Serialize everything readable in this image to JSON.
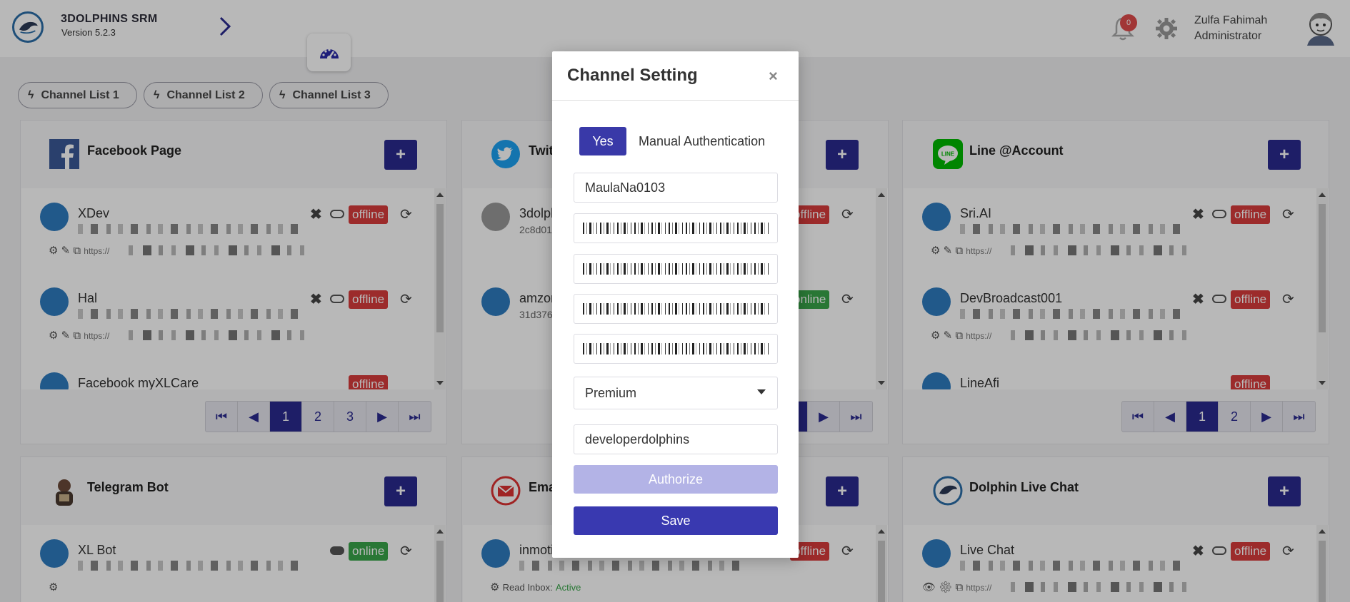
{
  "app": {
    "name": "3DOLPHINS SRM",
    "version": "Version 5.2.3"
  },
  "header": {
    "notification_count": "0",
    "user_name": "Zulfa Fahimah",
    "user_role": "Administrator"
  },
  "tabs": [
    {
      "label": "Channel List 1"
    },
    {
      "label": "Channel List 2"
    },
    {
      "label": "Channel List 3"
    }
  ],
  "panels": {
    "facebook": {
      "title": "Facebook Page",
      "items": [
        {
          "name": "XDev",
          "status": "offline",
          "url_prefix": "https://"
        },
        {
          "name": "Hal",
          "status": "offline",
          "url_prefix": "https://"
        },
        {
          "name": "Facebook myXLCare",
          "status": "offline"
        }
      ],
      "pages": [
        "1",
        "2",
        "3"
      ],
      "active_page": "1"
    },
    "twitter": {
      "title": "Twit",
      "items": [
        {
          "name": "3dolph",
          "sub": "2c8d01",
          "status": "offline"
        },
        {
          "name": "amzon",
          "sub": "31d376",
          "status": "online"
        }
      ]
    },
    "line": {
      "title": "Line @Account",
      "items": [
        {
          "name": "Sri.AI",
          "status": "offline",
          "url_prefix": "https://"
        },
        {
          "name": "DevBroadcast001",
          "status": "offline",
          "url_prefix": "https://"
        },
        {
          "name": "LineAfi",
          "status": "offline"
        }
      ],
      "pages": [
        "1",
        "2"
      ],
      "active_page": "1"
    },
    "telegram": {
      "title": "Telegram Bot",
      "items": [
        {
          "name": "XL Bot",
          "status": "online"
        }
      ]
    },
    "email": {
      "title": "Ema",
      "items": [
        {
          "name": "inmoti",
          "status": "offline",
          "read_inbox_label": "Read Inbox:",
          "read_inbox_value": "Active"
        }
      ]
    },
    "livechat": {
      "title": "Dolphin Live Chat",
      "items": [
        {
          "name": "Live Chat",
          "status": "offline",
          "url_prefix": "https://"
        }
      ]
    }
  },
  "modal": {
    "title": "Channel Setting",
    "close": "×",
    "yes_label": "Yes",
    "manual_auth_label": "Manual Authentication",
    "username_value": "MaulaNa0103",
    "plan_value": "Premium",
    "env_value": "developerdolphins",
    "authorize_label": "Authorize",
    "save_label": "Save"
  },
  "colors": {
    "primary": "#2a2a8f",
    "offline": "#d93c3c",
    "online": "#3aa54a",
    "authorize_disabled": "#b3b3e6"
  }
}
